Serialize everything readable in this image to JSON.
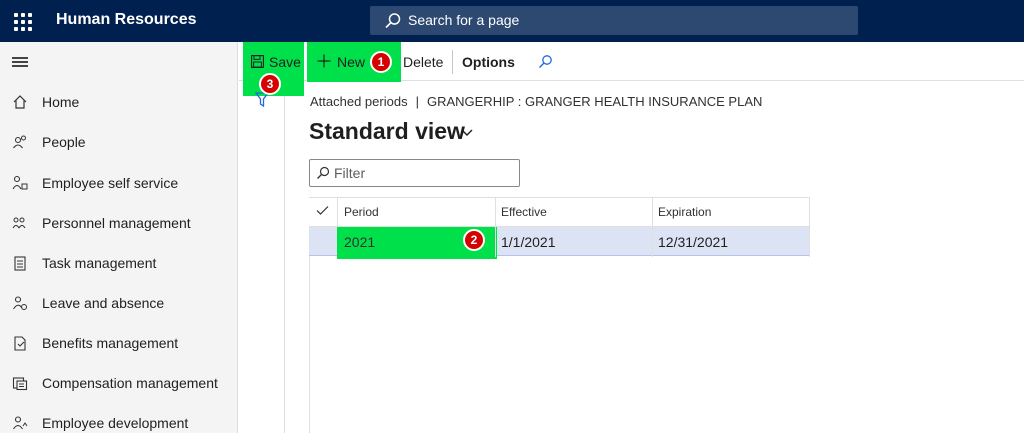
{
  "app": {
    "title": "Human Resources"
  },
  "search": {
    "placeholder": "Search for a page"
  },
  "nav": {
    "items": [
      {
        "label": "Home",
        "icon": "home-icon"
      },
      {
        "label": "People",
        "icon": "people-icon"
      },
      {
        "label": "Employee self service",
        "icon": "employee-self-service-icon"
      },
      {
        "label": "Personnel management",
        "icon": "personnel-management-icon"
      },
      {
        "label": "Task management",
        "icon": "task-management-icon"
      },
      {
        "label": "Leave and absence",
        "icon": "leave-absence-icon"
      },
      {
        "label": "Benefits management",
        "icon": "benefits-management-icon"
      },
      {
        "label": "Compensation management",
        "icon": "compensation-management-icon"
      },
      {
        "label": "Employee development",
        "icon": "employee-development-icon"
      }
    ]
  },
  "actions": {
    "save": "Save",
    "new": "New",
    "delete": "Delete",
    "options": "Options"
  },
  "callouts": {
    "one": "1",
    "two": "2",
    "three": "3"
  },
  "breadcrumb": {
    "parent": "Attached periods",
    "separator": "|",
    "current": "GRANGERHIP : GRANGER HEALTH INSURANCE PLAN"
  },
  "view": {
    "title": "Standard view"
  },
  "filter": {
    "placeholder": "Filter"
  },
  "grid": {
    "columns": [
      "Period",
      "Effective",
      "Expiration"
    ],
    "rows": [
      {
        "period": "2021",
        "effective": "1/1/2021",
        "expiration": "12/31/2021",
        "selected": true
      }
    ]
  },
  "colors": {
    "topbar": "#002050",
    "highlight": "#00e04b",
    "badge": "#d50000",
    "selected_row": "#dce3f4"
  }
}
